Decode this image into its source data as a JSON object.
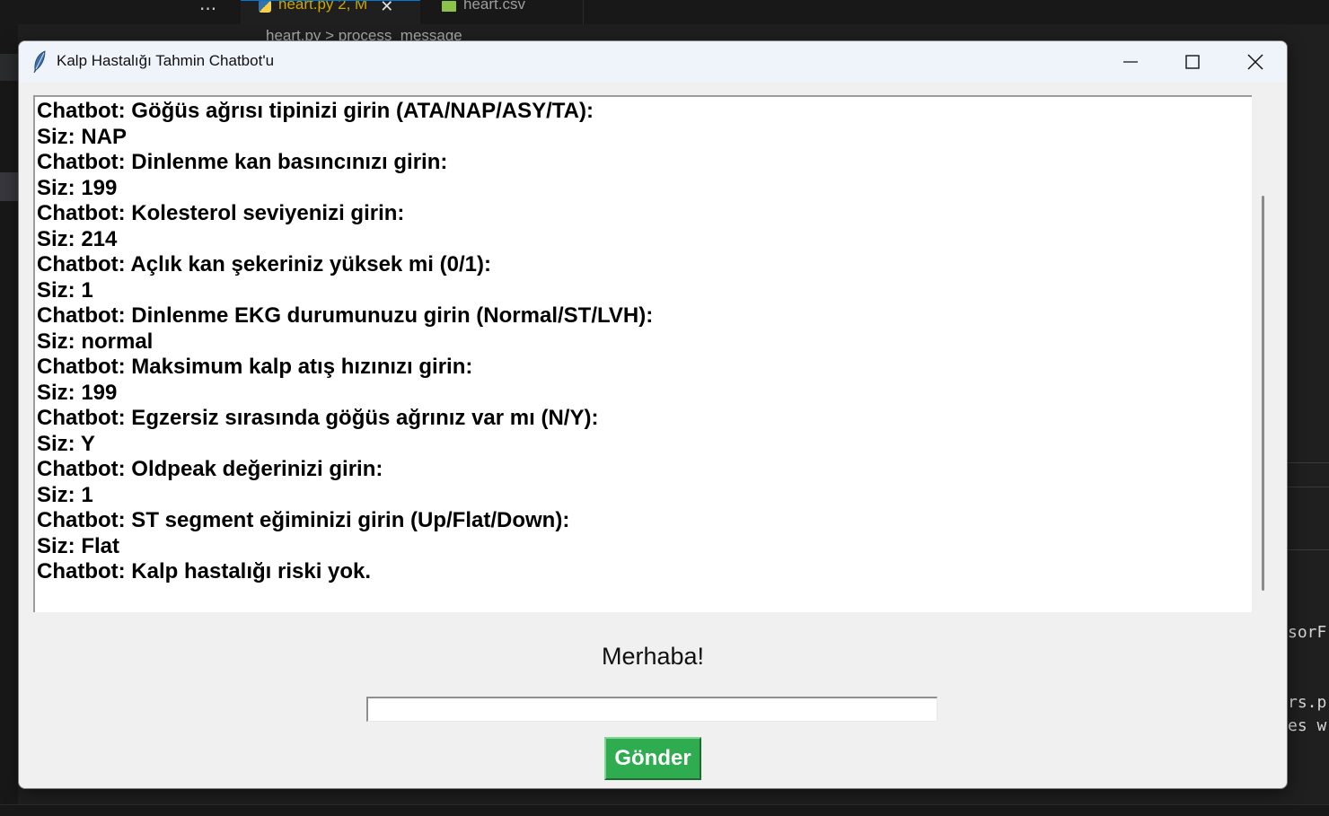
{
  "vscode": {
    "more_label": "...",
    "tabs": [
      {
        "label": "heart.py 2, M",
        "close": "✕"
      },
      {
        "label": "heart.csv"
      }
    ],
    "breadcrumb": "heart.py  >  process_message",
    "code_fragments": [
      "sorF",
      "rs.p",
      "es w"
    ]
  },
  "window": {
    "title": "Kalp Hastalığı Tahmin Chatbot'u",
    "controls": {
      "minimize": "—",
      "maximize": "☐",
      "close": "✕"
    }
  },
  "chat": {
    "lines": [
      "Chatbot: Göğüs ağrısı tipinizi girin (ATA/NAP/ASY/TA):",
      "Siz: NAP",
      "Chatbot: Dinlenme kan basıncınızı girin:",
      "Siz: 199",
      "Chatbot: Kolesterol seviyenizi girin:",
      "Siz: 214",
      "Chatbot: Açlık kan şekeriniz yüksek mi (0/1):",
      "Siz: 1",
      "Chatbot: Dinlenme EKG durumunuzu girin (Normal/ST/LVH):",
      "Siz: normal",
      "Chatbot: Maksimum kalp atış hızınızı girin:",
      "Siz: 199",
      "Chatbot: Egzersiz sırasında göğüs ağrınız var mı (N/Y):",
      "Siz: Y",
      "Chatbot: Oldpeak değerinizi girin:",
      "Siz: 1",
      "Chatbot: ST segment eğiminizi girin (Up/Flat/Down):",
      "Siz: Flat",
      "Chatbot: Kalp hastalığı riski yok."
    ]
  },
  "greeting": "Merhaba!",
  "input": {
    "value": ""
  },
  "send_button": {
    "label": "Gönder",
    "color": "#2fac4f"
  }
}
